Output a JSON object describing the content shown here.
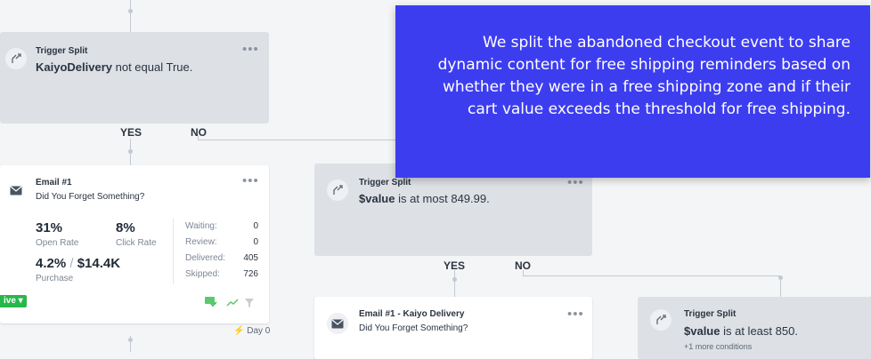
{
  "callout": {
    "text": "We split the abandoned checkout event to share dynamic content for free shipping reminders based on whether they were in a free shipping zone and if their cart value exceeds the threshold for free shipping."
  },
  "split1": {
    "title": "Trigger Split",
    "cond_bold": "KaiyoDelivery",
    "cond_rest": " not equal True.",
    "more": "•••",
    "yes": "YES",
    "no": "NO"
  },
  "email1": {
    "title": "Email #1",
    "subject": "Did You Forget Something?",
    "more": "•••",
    "open_rate": "31%",
    "open_rate_label": "Open Rate",
    "click_rate": "8%",
    "click_rate_label": "Click Rate",
    "purchase_pct": "4.2%",
    "purchase_sep": " / ",
    "purchase_value": "$14.4K",
    "purchase_label": "Purchase",
    "stats": [
      {
        "label": "Waiting:",
        "value": "0"
      },
      {
        "label": "Review:",
        "value": "0"
      },
      {
        "label": "Delivered:",
        "value": "405"
      },
      {
        "label": "Skipped:",
        "value": "726"
      }
    ],
    "status": "ive ▾",
    "status_color": "#27b84a",
    "delay": "Day 0"
  },
  "split2": {
    "title": "Trigger Split",
    "cond_bold": "$value",
    "cond_rest": " is at most 849.99.",
    "more": "•••",
    "yes": "YES",
    "no": "NO"
  },
  "email2": {
    "title": "Email #1 - Kaiyo Delivery",
    "subject": "Did You Forget Something?",
    "more": "•••"
  },
  "split3": {
    "title": "Trigger Split",
    "cond_bold": "$value",
    "cond_rest": " is at least 850.",
    "extra": "+1 more conditions"
  },
  "colors": {
    "callout_bg": "#3d3df0",
    "card_gray": "#dde1e6",
    "connector": "#c3c9d0",
    "live_green": "#27b84a"
  },
  "icons": [
    "split-icon",
    "mail-icon",
    "more-icon",
    "check-mail-icon",
    "trend-icon",
    "filter-icon",
    "bolt-icon"
  ]
}
